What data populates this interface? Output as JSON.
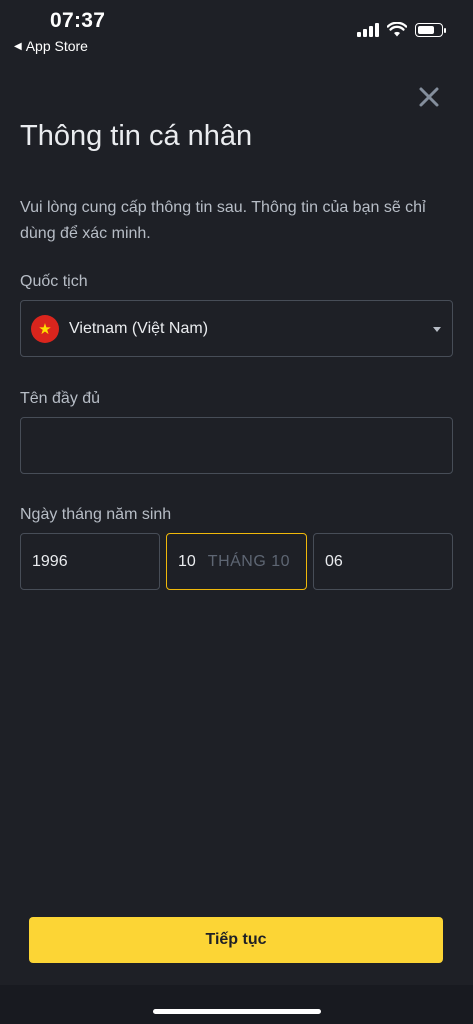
{
  "status_bar": {
    "time": "07:37",
    "back_app": "App Store",
    "signal_icon": "cellular-signal-icon",
    "wifi_icon": "wifi-icon",
    "battery_icon": "battery-icon",
    "battery_level": 0.6
  },
  "header": {
    "close_icon": "close-icon",
    "title": "Thông tin cá nhân",
    "description": "Vui lòng cung cấp thông tin sau. Thông tin của bạn sẽ chỉ dùng để xác minh."
  },
  "nationality": {
    "label": "Quốc tịch",
    "flag_icon": "vietnam-flag-icon",
    "value": "Vietnam (Việt Nam)",
    "caret_icon": "caret-down-icon"
  },
  "full_name": {
    "label": "Tên đầy đủ",
    "value": ""
  },
  "birth_date": {
    "label": "Ngày tháng năm sinh",
    "year": "1996",
    "month_value": "10",
    "month_placeholder": "THÁNG 10",
    "day": "06"
  },
  "actions": {
    "continue_label": "Tiếp tục"
  },
  "colors": {
    "background": "#1e2026",
    "accent": "#fcd535",
    "active_border": "#f0b90b",
    "border": "#474d57",
    "text_primary": "#eaecef",
    "text_secondary": "#b7bdc6"
  }
}
